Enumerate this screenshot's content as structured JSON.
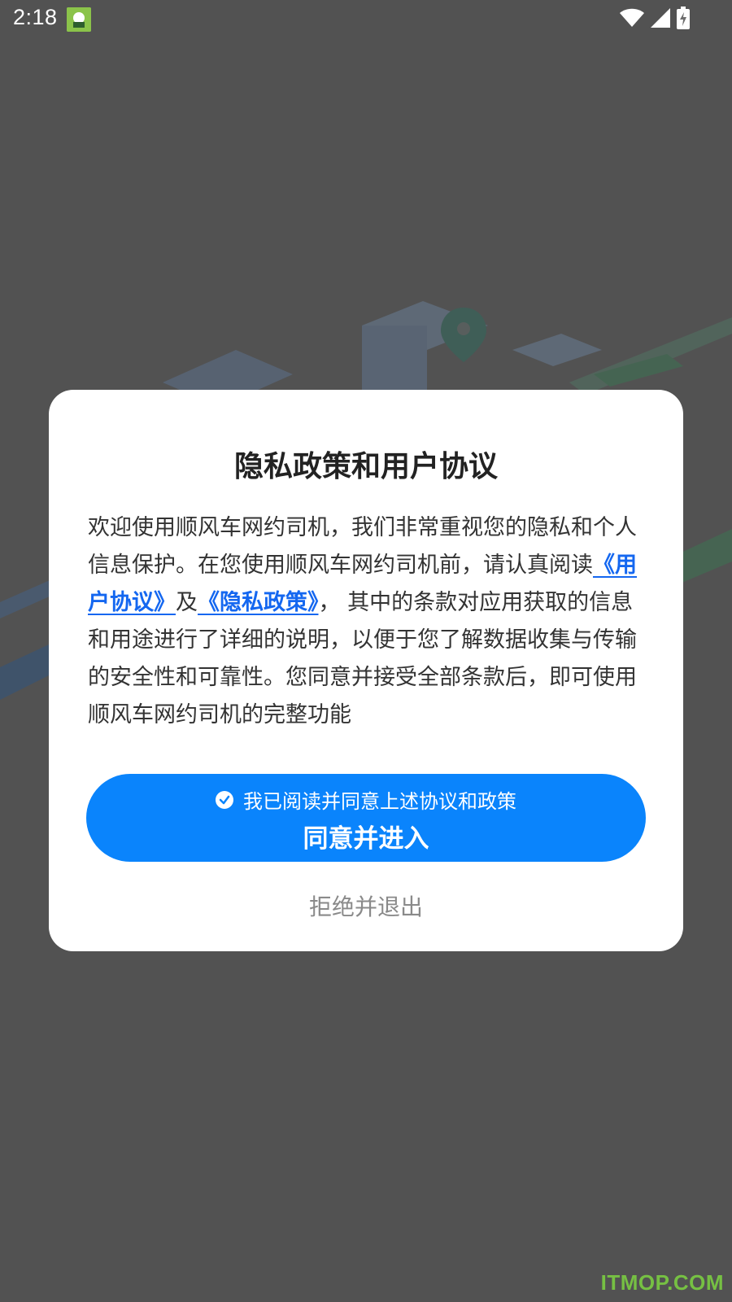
{
  "status_bar": {
    "time": "2:18",
    "icons": [
      "app-notification-icon",
      "wifi-icon",
      "cellular-signal-icon",
      "battery-charging-icon"
    ]
  },
  "dialog": {
    "title": "隐私政策和用户协议",
    "body_part1": "欢迎使用顺风车网约司机，我们非常重视您的隐私和个人信息保护。在您使用顺风车网约司机前，请认真阅读",
    "user_agreement_link": "《用户协议》",
    "connector": "及",
    "privacy_policy_link": "《隐私政策》",
    "body_part2": "， 其中的条款对应用获取的信息和用途进行了详细的说明，以便于您了解数据收集与传输的安全性和可靠性。您同意并接受全部条款后，即可使用顺风车网约司机的完整功能",
    "checkbox_label": "我已阅读并同意上述协议和政策",
    "checkbox_checked": true,
    "agree_button": "同意并进入",
    "reject_button": "拒绝并退出"
  },
  "watermark": "ITMOP.COM",
  "colors": {
    "primary": "#0a84fc",
    "link": "#1467f0",
    "overlay": "#6d6d6d",
    "watermark": "#76c043"
  }
}
